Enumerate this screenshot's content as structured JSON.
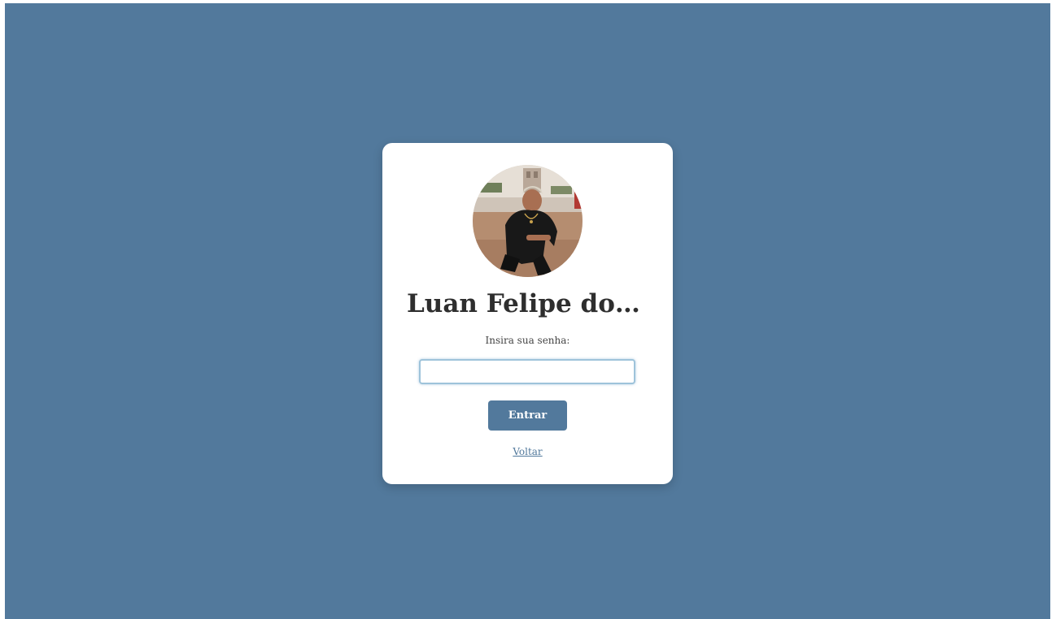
{
  "login": {
    "profile_name": "Luan Felipe dos S...",
    "password_label": "Insira sua senha:",
    "password_value": "",
    "password_placeholder": "",
    "submit_label": "Entrar",
    "back_label": "Voltar"
  },
  "colors": {
    "background": "#52799c",
    "card": "#ffffff",
    "accent": "#52799c",
    "title_text": "#2e2e2e"
  },
  "icons": {
    "avatar": "profile-photo"
  }
}
